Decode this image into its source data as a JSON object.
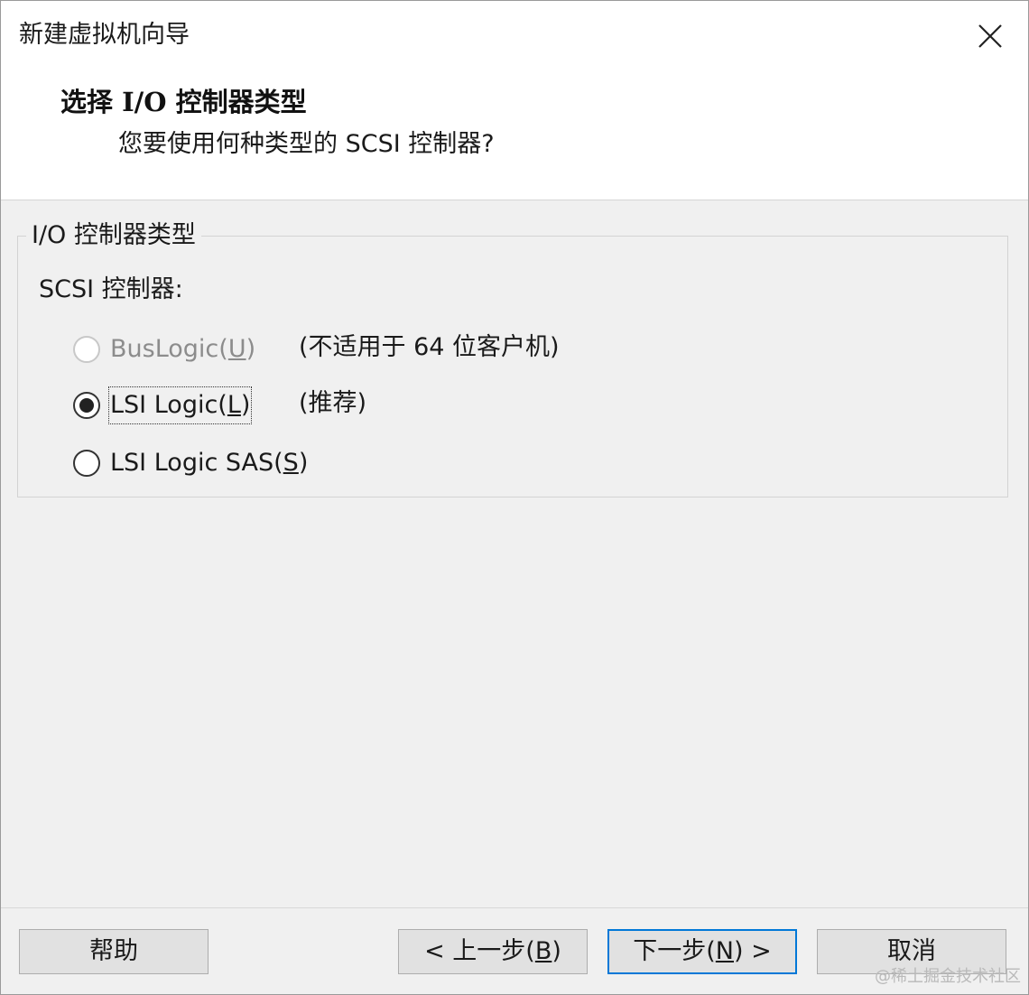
{
  "window": {
    "title": "新建虚拟机向导"
  },
  "header": {
    "heading": "选择 I/O 控制器类型",
    "subheading": "您要使用何种类型的 SCSI 控制器?"
  },
  "group": {
    "legend": "I/O 控制器类型",
    "section_label": "SCSI 控制器:",
    "options": [
      {
        "label_prefix": "BusLogic(",
        "mnemonic": "U",
        "label_suffix": ")",
        "note": "(不适用于 64 位客户机)",
        "selected": false,
        "enabled": false
      },
      {
        "label_prefix": "LSI Logic(",
        "mnemonic": "L",
        "label_suffix": ")",
        "note": "(推荐)",
        "selected": true,
        "enabled": true
      },
      {
        "label_prefix": "LSI Logic SAS(",
        "mnemonic": "S",
        "label_suffix": ")",
        "note": "",
        "selected": false,
        "enabled": true
      }
    ]
  },
  "footer": {
    "help": "帮助",
    "back_prefix": "< 上一步(",
    "back_mnemonic": "B",
    "back_suffix": ")",
    "next_prefix": "下一步(",
    "next_mnemonic": "N",
    "next_suffix": ") >",
    "cancel": "取消"
  },
  "watermark": "@稀土掘金技术社区",
  "colors": {
    "focus_border": "#0078d7",
    "button_face": "#e1e1e1",
    "dialog_bg": "#f0f0f0",
    "disabled_text": "#8c8c8c"
  },
  "icons": {
    "close": "close-icon"
  }
}
